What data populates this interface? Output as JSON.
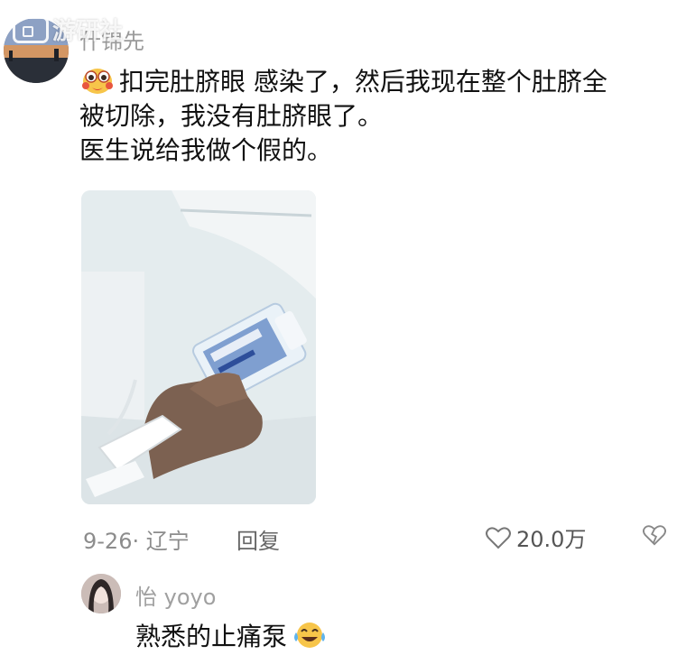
{
  "watermark": {
    "text": "游研社"
  },
  "post": {
    "username": "什锦先",
    "lines": [
      "扣完肚脐眼 感染了，然后我现在整个肚脐全",
      "被切除，我没有肚脐眼了。",
      "医生说给我做个假的。"
    ],
    "emoji_icon": "pleading-face-emoji",
    "date_location": "9-26· 辽宁",
    "reply_label": "回复",
    "likes": "20.0万"
  },
  "reply": {
    "username": "怡 yoyo",
    "text": "熟悉的止痛泵",
    "emoji_icon": "crying-laughing-emoji"
  },
  "colors": {
    "text_primary": "#111111",
    "text_muted": "#9a9a9a",
    "background": "#ffffff"
  }
}
